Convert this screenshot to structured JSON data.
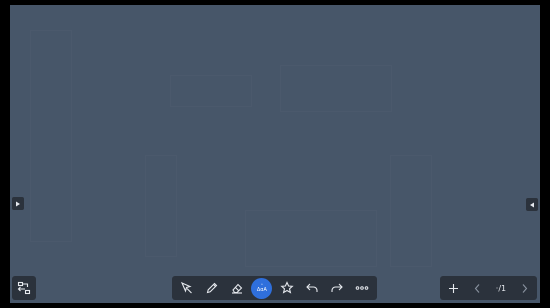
{
  "board": {
    "background": "#475669"
  },
  "toolbar": {
    "active_tool_badge_top": "▫",
    "active_tool_badge_text": "ΔαA",
    "tools": [
      "select-icon",
      "pen-icon",
      "eraser-icon",
      "text-shape-icon",
      "star-icon",
      "undo-icon",
      "redo-icon",
      "more-icon"
    ]
  },
  "pages": {
    "indicator": "·/1"
  },
  "colors": {
    "tray": "#2b323c",
    "accent": "#2f6fdc",
    "icon": "#e6e9ee"
  }
}
